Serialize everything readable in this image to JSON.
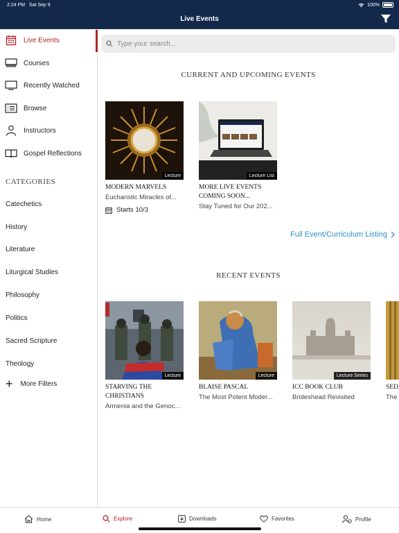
{
  "status_bar": {
    "time": "2:24 PM",
    "date": "Sat Sep 9",
    "battery": "100%"
  },
  "header": {
    "title": "Live Events"
  },
  "sidebar": {
    "nav": [
      {
        "label": "Live Events",
        "icon": "calendar-icon",
        "active": true
      },
      {
        "label": "Courses",
        "icon": "classroom-icon"
      },
      {
        "label": "Recently Watched",
        "icon": "monitor-icon"
      },
      {
        "label": "Browse",
        "icon": "list-icon"
      },
      {
        "label": "Instructors",
        "icon": "person-icon"
      },
      {
        "label": "Gospel Reflections",
        "icon": "book-icon"
      }
    ],
    "categories_heading": "CATEGORIES",
    "categories": [
      "Catechetics",
      "History",
      "Literature",
      "Liturgical Studies",
      "Philosophy",
      "Politics",
      "Sacred Scripture",
      "Theology"
    ],
    "more_filters": "More Filters"
  },
  "search": {
    "placeholder": "Type your search..."
  },
  "current": {
    "title": "CURRENT AND UPCOMING EVENTS",
    "cards": [
      {
        "badge": "Lecture",
        "title": "MODERN MARVELS",
        "subtitle": "Eucharistic Miracles of...",
        "date": "Starts 10/3"
      },
      {
        "badge": "Lecture List",
        "title": "MORE LIVE EVENTS COMING SOON...",
        "subtitle": "Stay Tuned for Our 202..."
      }
    ],
    "full_listing": "Full Event/Curriculum Listing"
  },
  "recent": {
    "title": "RECENT EVENTS",
    "cards": [
      {
        "badge": "Lecture",
        "title": "STARVING THE CHRISTIANS",
        "subtitle": "Armenia and the Genoc..."
      },
      {
        "badge": "Lecture",
        "title": "BLAISE PASCAL",
        "subtitle": "The Most Potent Moder..."
      },
      {
        "badge": "Lecture Series",
        "title": "ICC BOOK CLUB",
        "subtitle": "Brideshead Revisited"
      },
      {
        "title": "SEDI",
        "subtitle": "The"
      }
    ]
  },
  "tabbar": {
    "tabs": [
      {
        "label": "Home",
        "icon": "home-icon"
      },
      {
        "label": "Explore",
        "icon": "search-icon",
        "active": true
      },
      {
        "label": "Downloads",
        "icon": "download-icon"
      },
      {
        "label": "Favorites",
        "icon": "heart-icon"
      },
      {
        "label": "Profile",
        "icon": "profile-icon"
      }
    ]
  },
  "colors": {
    "header_bg": "#13294b",
    "accent_red": "#b22222",
    "link_blue": "#2a8fc9"
  }
}
